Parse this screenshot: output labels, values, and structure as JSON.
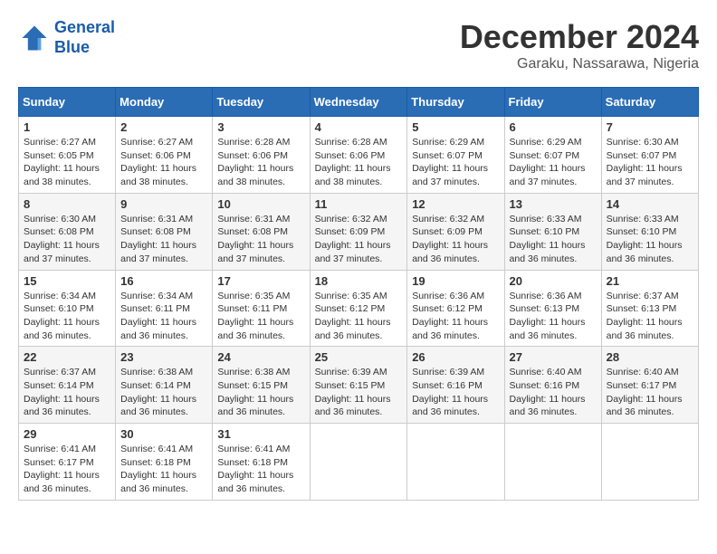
{
  "header": {
    "logo_line1": "General",
    "logo_line2": "Blue",
    "month": "December 2024",
    "location": "Garaku, Nassarawa, Nigeria"
  },
  "days_of_week": [
    "Sunday",
    "Monday",
    "Tuesday",
    "Wednesday",
    "Thursday",
    "Friday",
    "Saturday"
  ],
  "weeks": [
    [
      {
        "day": "1",
        "sunrise": "6:27 AM",
        "sunset": "6:05 PM",
        "daylight": "11 hours and 38 minutes."
      },
      {
        "day": "2",
        "sunrise": "6:27 AM",
        "sunset": "6:06 PM",
        "daylight": "11 hours and 38 minutes."
      },
      {
        "day": "3",
        "sunrise": "6:28 AM",
        "sunset": "6:06 PM",
        "daylight": "11 hours and 38 minutes."
      },
      {
        "day": "4",
        "sunrise": "6:28 AM",
        "sunset": "6:06 PM",
        "daylight": "11 hours and 38 minutes."
      },
      {
        "day": "5",
        "sunrise": "6:29 AM",
        "sunset": "6:07 PM",
        "daylight": "11 hours and 37 minutes."
      },
      {
        "day": "6",
        "sunrise": "6:29 AM",
        "sunset": "6:07 PM",
        "daylight": "11 hours and 37 minutes."
      },
      {
        "day": "7",
        "sunrise": "6:30 AM",
        "sunset": "6:07 PM",
        "daylight": "11 hours and 37 minutes."
      }
    ],
    [
      {
        "day": "8",
        "sunrise": "6:30 AM",
        "sunset": "6:08 PM",
        "daylight": "11 hours and 37 minutes."
      },
      {
        "day": "9",
        "sunrise": "6:31 AM",
        "sunset": "6:08 PM",
        "daylight": "11 hours and 37 minutes."
      },
      {
        "day": "10",
        "sunrise": "6:31 AM",
        "sunset": "6:08 PM",
        "daylight": "11 hours and 37 minutes."
      },
      {
        "day": "11",
        "sunrise": "6:32 AM",
        "sunset": "6:09 PM",
        "daylight": "11 hours and 37 minutes."
      },
      {
        "day": "12",
        "sunrise": "6:32 AM",
        "sunset": "6:09 PM",
        "daylight": "11 hours and 36 minutes."
      },
      {
        "day": "13",
        "sunrise": "6:33 AM",
        "sunset": "6:10 PM",
        "daylight": "11 hours and 36 minutes."
      },
      {
        "day": "14",
        "sunrise": "6:33 AM",
        "sunset": "6:10 PM",
        "daylight": "11 hours and 36 minutes."
      }
    ],
    [
      {
        "day": "15",
        "sunrise": "6:34 AM",
        "sunset": "6:10 PM",
        "daylight": "11 hours and 36 minutes."
      },
      {
        "day": "16",
        "sunrise": "6:34 AM",
        "sunset": "6:11 PM",
        "daylight": "11 hours and 36 minutes."
      },
      {
        "day": "17",
        "sunrise": "6:35 AM",
        "sunset": "6:11 PM",
        "daylight": "11 hours and 36 minutes."
      },
      {
        "day": "18",
        "sunrise": "6:35 AM",
        "sunset": "6:12 PM",
        "daylight": "11 hours and 36 minutes."
      },
      {
        "day": "19",
        "sunrise": "6:36 AM",
        "sunset": "6:12 PM",
        "daylight": "11 hours and 36 minutes."
      },
      {
        "day": "20",
        "sunrise": "6:36 AM",
        "sunset": "6:13 PM",
        "daylight": "11 hours and 36 minutes."
      },
      {
        "day": "21",
        "sunrise": "6:37 AM",
        "sunset": "6:13 PM",
        "daylight": "11 hours and 36 minutes."
      }
    ],
    [
      {
        "day": "22",
        "sunrise": "6:37 AM",
        "sunset": "6:14 PM",
        "daylight": "11 hours and 36 minutes."
      },
      {
        "day": "23",
        "sunrise": "6:38 AM",
        "sunset": "6:14 PM",
        "daylight": "11 hours and 36 minutes."
      },
      {
        "day": "24",
        "sunrise": "6:38 AM",
        "sunset": "6:15 PM",
        "daylight": "11 hours and 36 minutes."
      },
      {
        "day": "25",
        "sunrise": "6:39 AM",
        "sunset": "6:15 PM",
        "daylight": "11 hours and 36 minutes."
      },
      {
        "day": "26",
        "sunrise": "6:39 AM",
        "sunset": "6:16 PM",
        "daylight": "11 hours and 36 minutes."
      },
      {
        "day": "27",
        "sunrise": "6:40 AM",
        "sunset": "6:16 PM",
        "daylight": "11 hours and 36 minutes."
      },
      {
        "day": "28",
        "sunrise": "6:40 AM",
        "sunset": "6:17 PM",
        "daylight": "11 hours and 36 minutes."
      }
    ],
    [
      {
        "day": "29",
        "sunrise": "6:41 AM",
        "sunset": "6:17 PM",
        "daylight": "11 hours and 36 minutes."
      },
      {
        "day": "30",
        "sunrise": "6:41 AM",
        "sunset": "6:18 PM",
        "daylight": "11 hours and 36 minutes."
      },
      {
        "day": "31",
        "sunrise": "6:41 AM",
        "sunset": "6:18 PM",
        "daylight": "11 hours and 36 minutes."
      },
      null,
      null,
      null,
      null
    ]
  ]
}
